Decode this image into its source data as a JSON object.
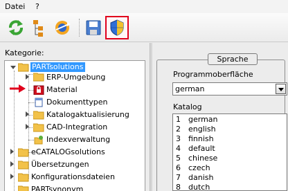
{
  "menu": {
    "file": "Datei",
    "help": "?"
  },
  "toolbar": {
    "buttons": [
      {
        "icon": "refresh-icon"
      },
      {
        "icon": "hierarchy-icon"
      },
      {
        "icon": "transfer-icon"
      },
      {
        "icon": "save-icon"
      },
      {
        "icon": "shield-icon",
        "highlighted": true
      }
    ]
  },
  "left": {
    "category_label": "Kategorie:",
    "tree": [
      {
        "label": "PARTsolutions",
        "selected": true
      },
      {
        "label": "ERP-Umgebung"
      },
      {
        "label": "Material",
        "locked": true,
        "pointed": true
      },
      {
        "label": "Dokumenttypen"
      },
      {
        "label": "Katalogaktualisierung"
      },
      {
        "label": "CAD-Integration"
      },
      {
        "label": "Indexverwaltung"
      },
      {
        "label": "eCATALOGsolutions"
      },
      {
        "label": "Übersetzungen"
      },
      {
        "label": "Konfigurationsdateien"
      },
      {
        "label": "PARTsynonym"
      }
    ]
  },
  "right": {
    "group_title": "Sprache",
    "ui_label": "Programmoberfläche",
    "ui_value": "german",
    "catalog_label": "Katalog",
    "catalog": [
      {
        "num": "1",
        "name": "german"
      },
      {
        "num": "2",
        "name": "english"
      },
      {
        "num": "3",
        "name": "finnish"
      },
      {
        "num": "4",
        "name": "default"
      },
      {
        "num": "5",
        "name": "chinese"
      },
      {
        "num": "6",
        "name": "czech"
      },
      {
        "num": "7",
        "name": "danish"
      },
      {
        "num": "8",
        "name": "dutch"
      }
    ]
  },
  "colors": {
    "selection": "#3399ff",
    "highlight": "#e0001c",
    "folder": "#f2c24a"
  }
}
